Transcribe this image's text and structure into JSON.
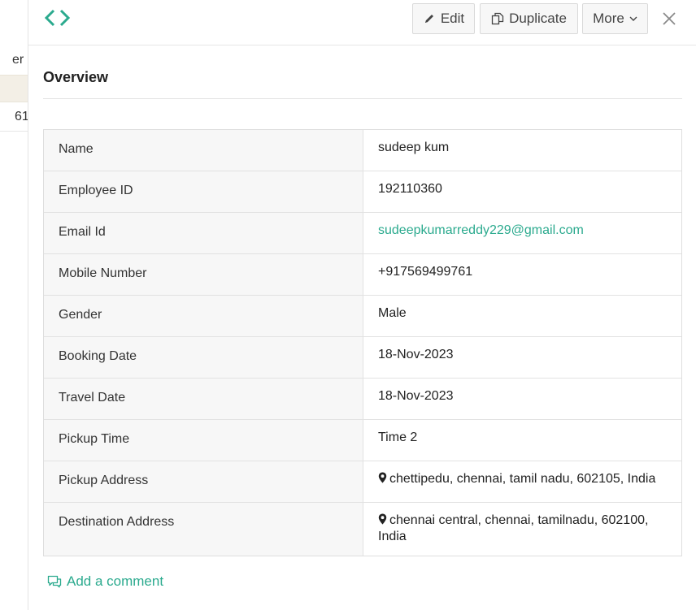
{
  "background_list": {
    "header_fragment": "er",
    "row_fragment": "61"
  },
  "toolbar": {
    "logo_icon": "code-brackets-icon",
    "edit_label": "Edit",
    "duplicate_label": "Duplicate",
    "more_label": "More",
    "close_icon": "close-icon"
  },
  "section": {
    "title": "Overview"
  },
  "details": [
    {
      "label": "Name",
      "value": "sudeep kum"
    },
    {
      "label": "Employee ID",
      "value": "192110360"
    },
    {
      "label": "Email Id",
      "value": "sudeepkumarreddy229@gmail.com"
    },
    {
      "label": "Mobile Number",
      "value": "+917569499761"
    },
    {
      "label": "Gender",
      "value": "Male"
    },
    {
      "label": "Booking Date",
      "value": "18-Nov-2023"
    },
    {
      "label": "Travel Date",
      "value": "18-Nov-2023"
    },
    {
      "label": "Pickup Time",
      "value": "Time 2"
    },
    {
      "label": "Pickup Address",
      "value": "chettipedu, chennai, tamil nadu, 602105, India"
    },
    {
      "label": "Destination Address",
      "value": "chennai central, chennai, tamilnadu, 602100, India"
    }
  ],
  "comment": {
    "label": "Add a comment"
  },
  "colors": {
    "accent": "#2baa8e",
    "label_bg": "#f7f7f7",
    "border": "#e2e2e2"
  }
}
